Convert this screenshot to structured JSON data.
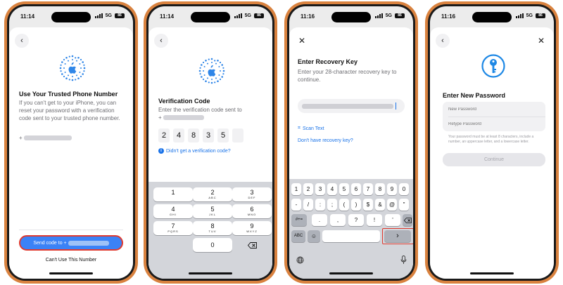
{
  "screens": [
    {
      "time": "11:14",
      "network": "5G",
      "battery": "86",
      "title": "Use Your Trusted Phone Number",
      "description": "If you can't get to your iPhone, you can reset your password with a verification code sent to your trusted phone number.",
      "phone_prefix": "+",
      "send_button": "Send code to +",
      "alt_button": "Can't Use This Number"
    },
    {
      "time": "11:14",
      "network": "5G",
      "battery": "86",
      "title": "Verification Code",
      "description": "Enter the verification code sent to",
      "phone_prefix": "+",
      "code_digits": [
        "2",
        "4",
        "8",
        "3",
        "5",
        ""
      ],
      "help_link": "Didn't get a verification code?",
      "keypad": [
        {
          "n": "1",
          "l": ""
        },
        {
          "n": "2",
          "l": "ABC"
        },
        {
          "n": "3",
          "l": "DEF"
        },
        {
          "n": "4",
          "l": "GHI"
        },
        {
          "n": "5",
          "l": "JKL"
        },
        {
          "n": "6",
          "l": "MNO"
        },
        {
          "n": "7",
          "l": "PQRS"
        },
        {
          "n": "8",
          "l": "TUV"
        },
        {
          "n": "9",
          "l": "WXYZ"
        },
        {
          "n": "0",
          "l": ""
        }
      ]
    },
    {
      "time": "11:16",
      "network": "5G",
      "battery": "86",
      "title": "Enter Recovery Key",
      "description": "Enter your 28-character recovery key to continue.",
      "scan_text": "Scan Text",
      "no_key_link": "Don't have recovery key?",
      "row1": [
        "1",
        "2",
        "3",
        "4",
        "5",
        "6",
        "7",
        "8",
        "9",
        "0"
      ],
      "row2": [
        "-",
        "/",
        ":",
        ";",
        "(",
        ")",
        "$",
        "&",
        "@",
        "\""
      ],
      "row3_left": "#+=",
      "row3": [
        ".",
        ",",
        "?",
        "!",
        "'"
      ],
      "abc": "ABC",
      "next_key": "›"
    },
    {
      "time": "11:16",
      "network": "5G",
      "battery": "86",
      "title": "Enter New Password",
      "new_password_placeholder": "New Password",
      "retype_placeholder": "Retype Password",
      "hint": "Your password must be at least 8 characters, include a number, an uppercase letter, and a lowercase letter.",
      "continue_button": "Continue"
    }
  ],
  "colors": {
    "frame": "#d9823f",
    "accent_blue": "#1a73e8",
    "send_button_blue": "#3b82f6",
    "highlight_red": "#e03a2f",
    "key_icon_blue": "#1e88e5"
  }
}
